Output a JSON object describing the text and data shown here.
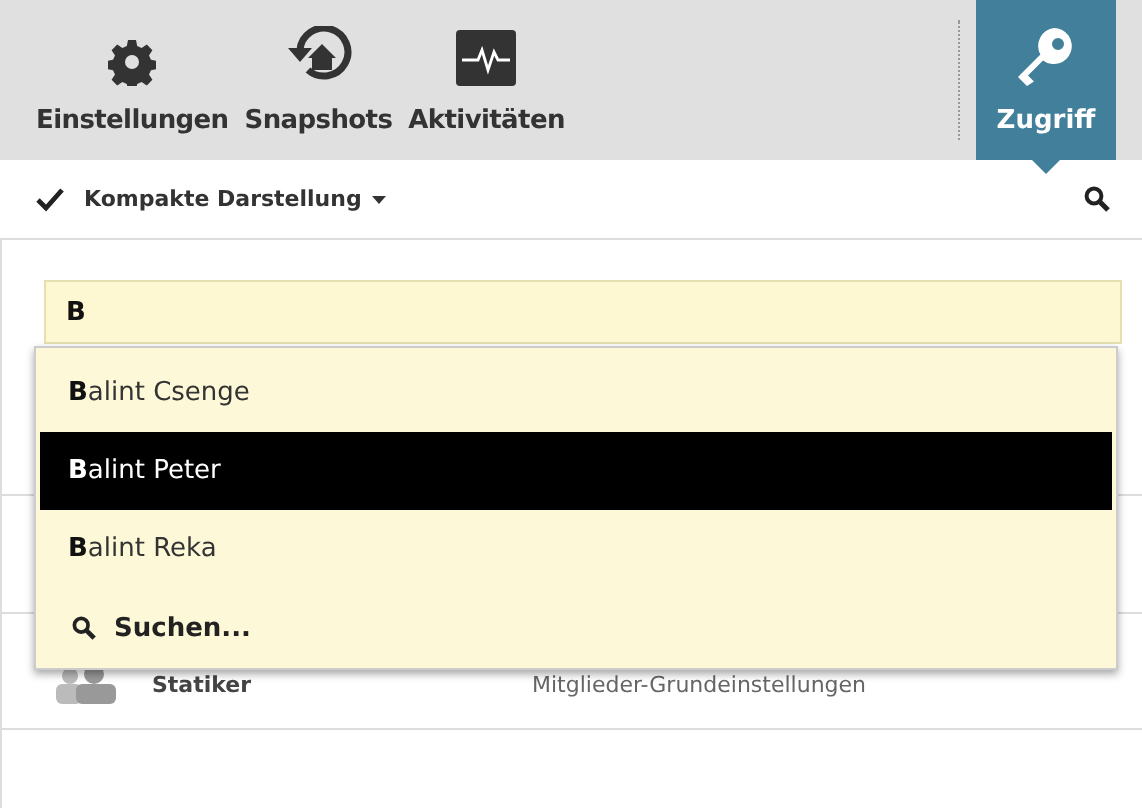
{
  "toolbar": {
    "tabs": [
      {
        "label": "Einstellungen",
        "kind": "gear",
        "selected": false
      },
      {
        "label": "Snapshots",
        "kind": "restore",
        "selected": false
      },
      {
        "label": "Aktivitäten",
        "kind": "pulse",
        "selected": false
      }
    ],
    "access_tab": {
      "label": "Zugriff",
      "selected": true
    }
  },
  "view_bar": {
    "checked": true,
    "view_menu": "Kompakte Darstellung"
  },
  "search_field": {
    "value": "B"
  },
  "suggestions": [
    {
      "label": "**B**alint Csenge",
      "selected": false
    },
    {
      "label": "**B**alint Peter",
      "selected": true
    },
    {
      "label": "**B**alint Reka",
      "selected": false
    }
  ],
  "search_action": "Suchen...",
  "list_row": {
    "name": "Statiker",
    "role": "Mitglieder-Grundeinstellungen"
  }
}
